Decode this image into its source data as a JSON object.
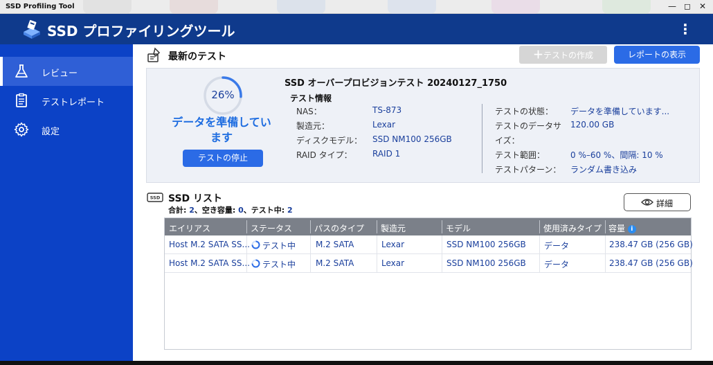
{
  "window": {
    "title": "SSD Profiling Tool"
  },
  "header": {
    "app_name": "SSD プロファイリングツール",
    "menu_glyph": "⋮"
  },
  "sidebar": {
    "items": [
      {
        "label": "レビュー",
        "icon": "flask-icon",
        "active": true
      },
      {
        "label": "テストレポート",
        "icon": "clipboard-icon",
        "active": false
      },
      {
        "label": "設定",
        "icon": "gear-icon",
        "active": false
      }
    ]
  },
  "latest": {
    "section_title": "最新のテスト",
    "create_label": "テストの作成",
    "report_label": "レポートの表示",
    "progress_percent": 26,
    "progress_text": "26%",
    "status_line1": "データを準備してい",
    "status_line2": "ます",
    "stop_label": "テストの停止",
    "test_name": "SSD オーバープロビジョンテスト 20240127_1750",
    "info_heading": "テスト情報",
    "left": [
      {
        "label": "NAS：",
        "value": "TS-873"
      },
      {
        "label": "製造元：",
        "value": "Lexar"
      },
      {
        "label": "ディスクモデル：",
        "value": "SSD NM100 256GB"
      },
      {
        "label": "RAID タイプ：",
        "value": "RAID 1"
      }
    ],
    "right": {
      "state_label": "テストの状態：",
      "state_value": "データを準備しています...",
      "size_label_1": "テストのデータサ",
      "size_label_2": "イズ：",
      "size_value": "120.00 GB",
      "range_label": "テスト範囲：",
      "range_value": "0 %–60 %、間隔: 10 %",
      "pattern_label": "テストパターン：",
      "pattern_value": "ランダム書き込み"
    }
  },
  "ssd_list": {
    "section_title": "SSD リスト",
    "summary": {
      "total_label": "合計: ",
      "total": "2",
      "free_label": "、空き容量: ",
      "free": "0",
      "testing_label": "、テスト中: ",
      "testing": "2"
    },
    "details_label": "詳細",
    "columns": [
      "エイリアス",
      "ステータス",
      "パスのタイプ",
      "製造元",
      "モデル",
      "使用済みタイプ",
      "容量"
    ],
    "rows": [
      [
        "Host M.2 SATA SS...",
        "テスト中",
        "M.2 SATA",
        "Lexar",
        "SSD NM100 256GB",
        "データ",
        "238.47 GB (256 GB)"
      ],
      [
        "Host M.2 SATA SS...",
        "テスト中",
        "M.2 SATA",
        "Lexar",
        "SSD NM100 256GB",
        "データ",
        "238.47 GB (256 GB)"
      ]
    ]
  },
  "colors": {
    "header": "#0f3a8c",
    "sidebar": "#0c42c6",
    "accent": "#2b6be6",
    "value_text": "#1a3f9c"
  }
}
